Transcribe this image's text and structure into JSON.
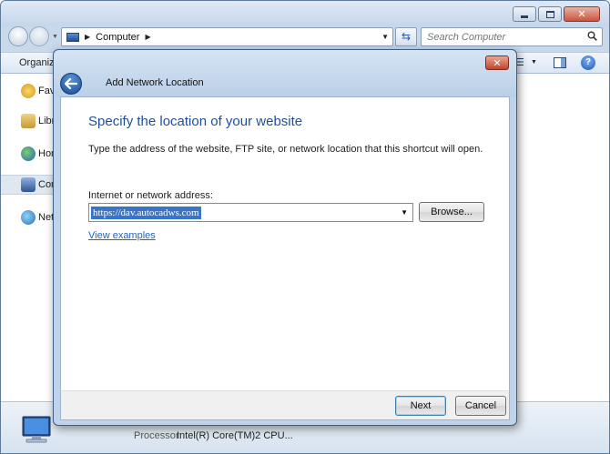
{
  "explorer": {
    "address": {
      "location": "Computer"
    },
    "search": {
      "placeholder": "Search Computer"
    },
    "toolbar": {
      "organize_label": "Organiz"
    },
    "nav_items": [
      {
        "label": "Favorites",
        "icon": "star-icon"
      },
      {
        "label": "Libraries",
        "icon": "library-icon"
      },
      {
        "label": "Homegroup",
        "icon": "homegroup-icon"
      },
      {
        "label": "Computer",
        "icon": "computer-icon"
      },
      {
        "label": "Network",
        "icon": "network-icon"
      }
    ],
    "status": {
      "processor_label": "Processor:",
      "processor_value": "Intel(R) Core(TM)2 CPU..."
    }
  },
  "dialog": {
    "title": "Add Network Location",
    "heading": "Specify the location of your website",
    "instruction": "Type the address of the website, FTP site, or network location that this shortcut will open.",
    "field_label": "Internet or network address:",
    "address_value": "https://dav.autocadws.com",
    "browse_label": "Browse...",
    "view_examples": "View examples",
    "next_label": "Next",
    "cancel_label": "Cancel"
  },
  "colors": {
    "heading": "#1f4f9b",
    "link": "#2064c4",
    "selection": "#3a74c6",
    "close_button": "#c2432c"
  }
}
